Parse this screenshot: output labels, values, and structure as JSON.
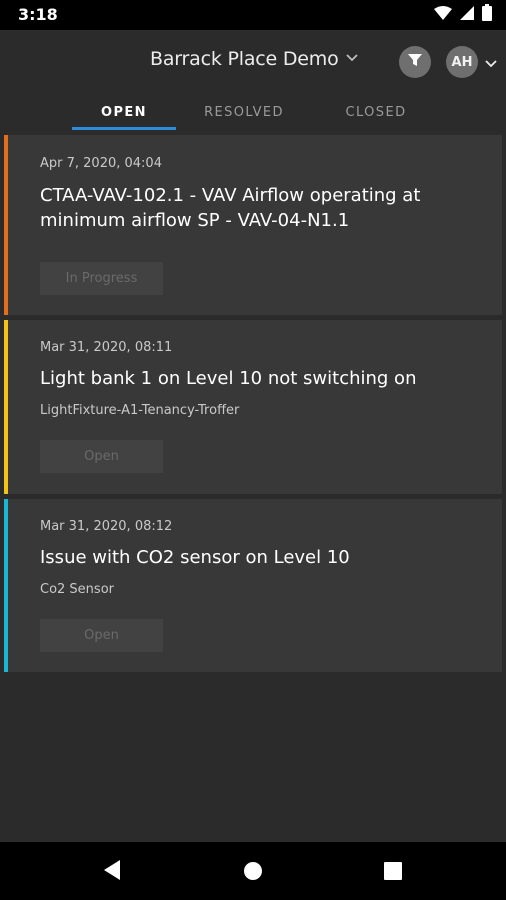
{
  "status_bar": {
    "time": "3:18",
    "icons": [
      "wifi-icon",
      "signal-icon",
      "battery-icon"
    ]
  },
  "header": {
    "project_title": "Barrack Place Demo",
    "avatar_initials": "AH",
    "icons": [
      "chevron-down-icon",
      "filter-icon",
      "chevron-down-icon"
    ]
  },
  "tabs": [
    {
      "label": "OPEN",
      "active": true
    },
    {
      "label": "RESOLVED",
      "active": false
    },
    {
      "label": "CLOSED",
      "active": false
    }
  ],
  "issues": [
    {
      "date": "Apr 7, 2020, 04:04",
      "title_lines": [
        "CTAA-VAV-102.1 - VAV Airflow operating at",
        "minimum airflow SP - VAV-04-N1.1"
      ],
      "subtitle": "",
      "status": "In Progress",
      "stripe_color": "#e0701e"
    },
    {
      "date": "Mar 31, 2020, 08:11",
      "title_lines": [
        "Light bank 1 on Level 10 not switching on"
      ],
      "subtitle": "LightFixture-A1-Tenancy-Troffer",
      "status": "Open",
      "stripe_color": "#f2c418"
    },
    {
      "date": "Mar 31, 2020, 08:12",
      "title_lines": [
        "Issue with CO2 sensor on Level 10"
      ],
      "subtitle": "Co2 Sensor",
      "status": "Open",
      "stripe_color": "#1ab6d4"
    }
  ],
  "colors": {
    "background": "#2b2b2b",
    "card": "#383838",
    "tab_indicator": "#2e8ddb"
  },
  "nav_bar": {
    "icons": [
      "back-icon",
      "home-icon",
      "recents-icon"
    ]
  }
}
